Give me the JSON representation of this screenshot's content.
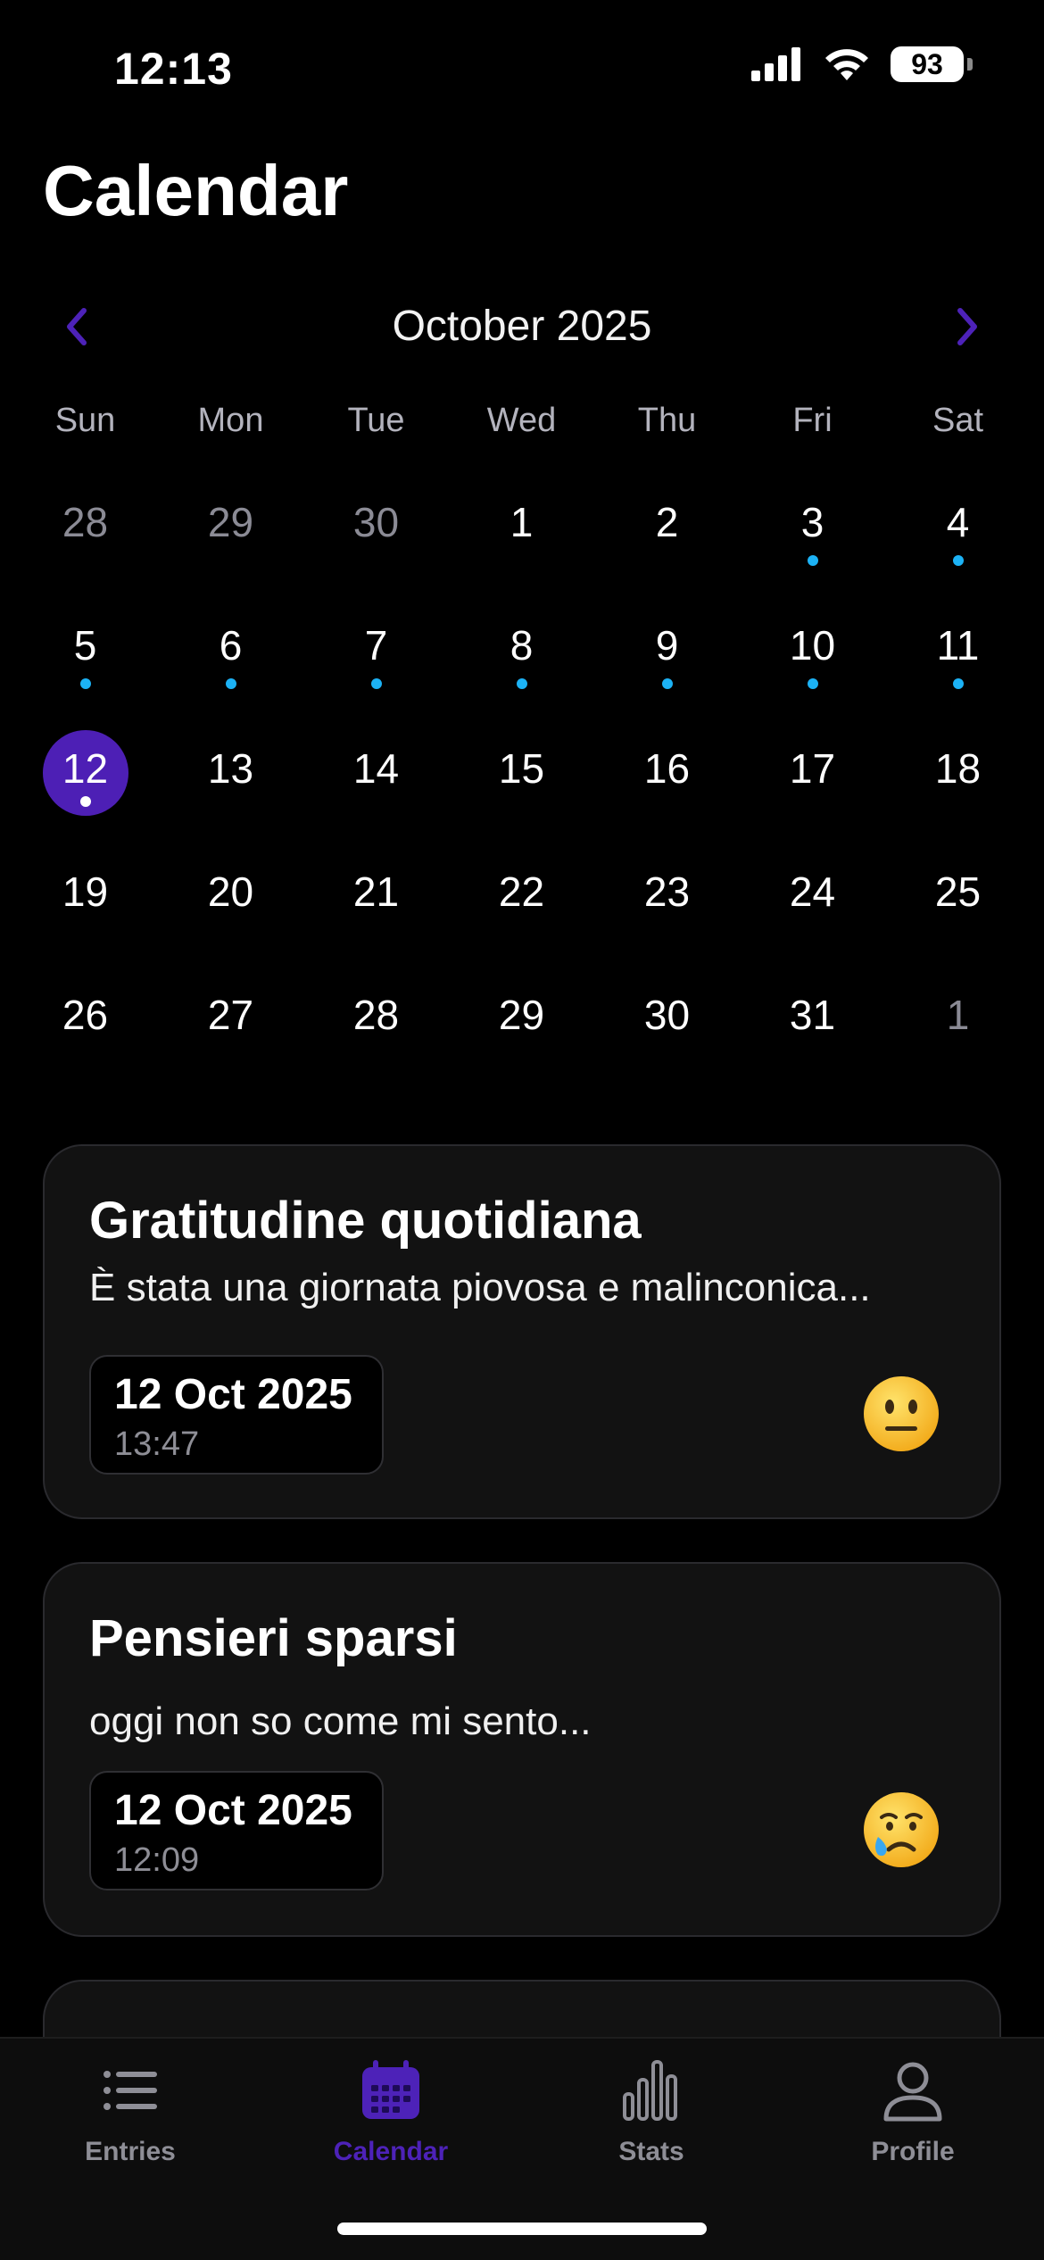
{
  "status_bar": {
    "time": "12:13",
    "battery": "93"
  },
  "page_title": "Calendar",
  "calendar": {
    "month_label": "October 2025",
    "weekdays": [
      "Sun",
      "Mon",
      "Tue",
      "Wed",
      "Thu",
      "Fri",
      "Sat"
    ],
    "weeks": [
      [
        {
          "n": "28",
          "other": true
        },
        {
          "n": "29",
          "other": true
        },
        {
          "n": "30",
          "other": true
        },
        {
          "n": "1"
        },
        {
          "n": "2"
        },
        {
          "n": "3",
          "dot": true
        },
        {
          "n": "4",
          "dot": true
        }
      ],
      [
        {
          "n": "5",
          "dot": true
        },
        {
          "n": "6",
          "dot": true
        },
        {
          "n": "7",
          "dot": true
        },
        {
          "n": "8",
          "dot": true
        },
        {
          "n": "9",
          "dot": true
        },
        {
          "n": "10",
          "dot": true
        },
        {
          "n": "11",
          "dot": true
        }
      ],
      [
        {
          "n": "12",
          "dot": true,
          "selected": true
        },
        {
          "n": "13"
        },
        {
          "n": "14"
        },
        {
          "n": "15"
        },
        {
          "n": "16"
        },
        {
          "n": "17"
        },
        {
          "n": "18"
        }
      ],
      [
        {
          "n": "19"
        },
        {
          "n": "20"
        },
        {
          "n": "21"
        },
        {
          "n": "22"
        },
        {
          "n": "23"
        },
        {
          "n": "24"
        },
        {
          "n": "25"
        }
      ],
      [
        {
          "n": "26"
        },
        {
          "n": "27"
        },
        {
          "n": "28"
        },
        {
          "n": "29"
        },
        {
          "n": "30"
        },
        {
          "n": "31"
        },
        {
          "n": "1",
          "other": true
        }
      ]
    ]
  },
  "entries": [
    {
      "title": "Gratitudine quotidiana",
      "excerpt": "È stata una giornata piovosa e malinconica...",
      "date": "12 Oct 2025",
      "time": "13:47",
      "mood_icon": "neutral-face-icon"
    },
    {
      "title": "Pensieri sparsi",
      "excerpt": "oggi non so come mi sento...",
      "date": "12 Oct 2025",
      "time": "12:09",
      "mood_icon": "crying-face-icon"
    }
  ],
  "tabs": [
    {
      "label": "Entries",
      "icon": "list-icon"
    },
    {
      "label": "Calendar",
      "icon": "calendar-icon",
      "active": true
    },
    {
      "label": "Stats",
      "icon": "bar-chart-icon"
    },
    {
      "label": "Profile",
      "icon": "person-icon"
    }
  ],
  "colors": {
    "accent": "#4d22b8",
    "dot": "#1cb2f5",
    "card_bg": "#121212"
  }
}
